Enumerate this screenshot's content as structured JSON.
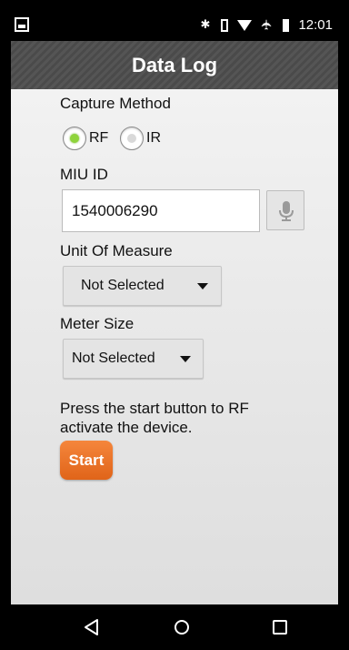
{
  "status_bar": {
    "time": "12:01",
    "icons": [
      "notification-icon",
      "bluetooth-icon",
      "vibrate-icon",
      "wifi-icon",
      "airplane-mode-icon",
      "battery-icon"
    ]
  },
  "app_bar": {
    "title": "Data Log"
  },
  "form": {
    "capture_method": {
      "label": "Capture Method",
      "options": [
        {
          "label": "RF",
          "selected": true
        },
        {
          "label": "IR",
          "selected": false
        }
      ]
    },
    "miu_id": {
      "label": "MIU ID",
      "value": "1540006290",
      "mic_icon": "microphone-icon"
    },
    "unit_of_measure": {
      "label": "Unit Of Measure",
      "value": "Not Selected"
    },
    "meter_size": {
      "label": "Meter Size",
      "value": "Not Selected"
    },
    "instruction": "Press the start button to RF activate the device.",
    "start_label": "Start"
  },
  "nav_bar": {
    "icons": [
      "back-icon",
      "home-icon",
      "recent-apps-icon"
    ]
  },
  "colors": {
    "accent": "#e8701f",
    "radio_selected": "#8fd43c",
    "app_bar": "#505050"
  }
}
